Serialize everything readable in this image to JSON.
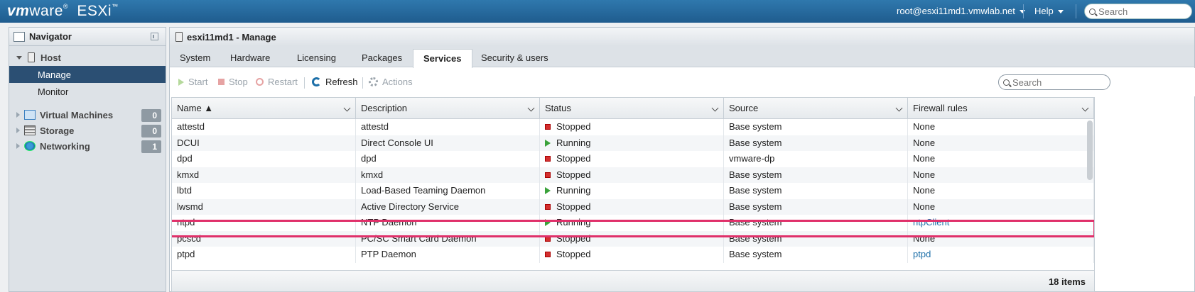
{
  "topbar": {
    "brand_vm": "vm",
    "brand_ware": "ware",
    "brand_product": "ESXi",
    "user": "root@esxi11md1.vmwlab.net",
    "help": "Help",
    "search_placeholder": "Search"
  },
  "navigator": {
    "title": "Navigator",
    "host": "Host",
    "host_items": [
      {
        "label": "Manage",
        "active": true
      },
      {
        "label": "Monitor",
        "active": false
      }
    ],
    "groups": [
      {
        "label": "Virtual Machines",
        "count": "0",
        "icon": "vm-icon"
      },
      {
        "label": "Storage",
        "count": "0",
        "icon": "storage-icon"
      },
      {
        "label": "Networking",
        "count": "1",
        "icon": "network-icon"
      }
    ]
  },
  "main": {
    "title": "esxi11md1 - Manage",
    "tabs": [
      "System",
      "Hardware",
      "Licensing",
      "Packages",
      "Services",
      "Security & users"
    ],
    "active_tab": "Services",
    "toolbar": {
      "start": "Start",
      "stop": "Stop",
      "restart": "Restart",
      "refresh": "Refresh",
      "actions": "Actions",
      "search_placeholder": "Search"
    },
    "grid": {
      "columns": [
        "Name ▲",
        "Description",
        "Status",
        "Source",
        "Firewall rules"
      ],
      "rows": [
        {
          "name": "attestd",
          "description": "attestd",
          "status": "Stopped",
          "source": "Base system",
          "firewall": "None"
        },
        {
          "name": "DCUI",
          "description": "Direct Console UI",
          "status": "Running",
          "source": "Base system",
          "firewall": "None"
        },
        {
          "name": "dpd",
          "description": "dpd",
          "status": "Stopped",
          "source": "vmware-dp",
          "firewall": "None"
        },
        {
          "name": "kmxd",
          "description": "kmxd",
          "status": "Stopped",
          "source": "Base system",
          "firewall": "None"
        },
        {
          "name": "lbtd",
          "description": "Load-Based Teaming Daemon",
          "status": "Running",
          "source": "Base system",
          "firewall": "None"
        },
        {
          "name": "lwsmd",
          "description": "Active Directory Service",
          "status": "Stopped",
          "source": "Base system",
          "firewall": "None"
        },
        {
          "name": "ntpd",
          "description": "NTP Daemon",
          "status": "Running",
          "source": "Base system",
          "firewall": "ntpClient"
        },
        {
          "name": "pcscd",
          "description": "PC/SC Smart Card Daemon",
          "status": "Stopped",
          "source": "Base system",
          "firewall": "None"
        },
        {
          "name": "ptpd",
          "description": "PTP Daemon",
          "status": "Stopped",
          "source": "Base system",
          "firewall": "ptpd"
        }
      ],
      "footer": "18 items"
    }
  },
  "colors": {
    "topbar": "#1f5c8e",
    "nav_active": "#2b4f73",
    "highlight": "#e0306a",
    "link": "#1c6fa8",
    "running": "#3aa23a",
    "stopped": "#d32f2f"
  }
}
